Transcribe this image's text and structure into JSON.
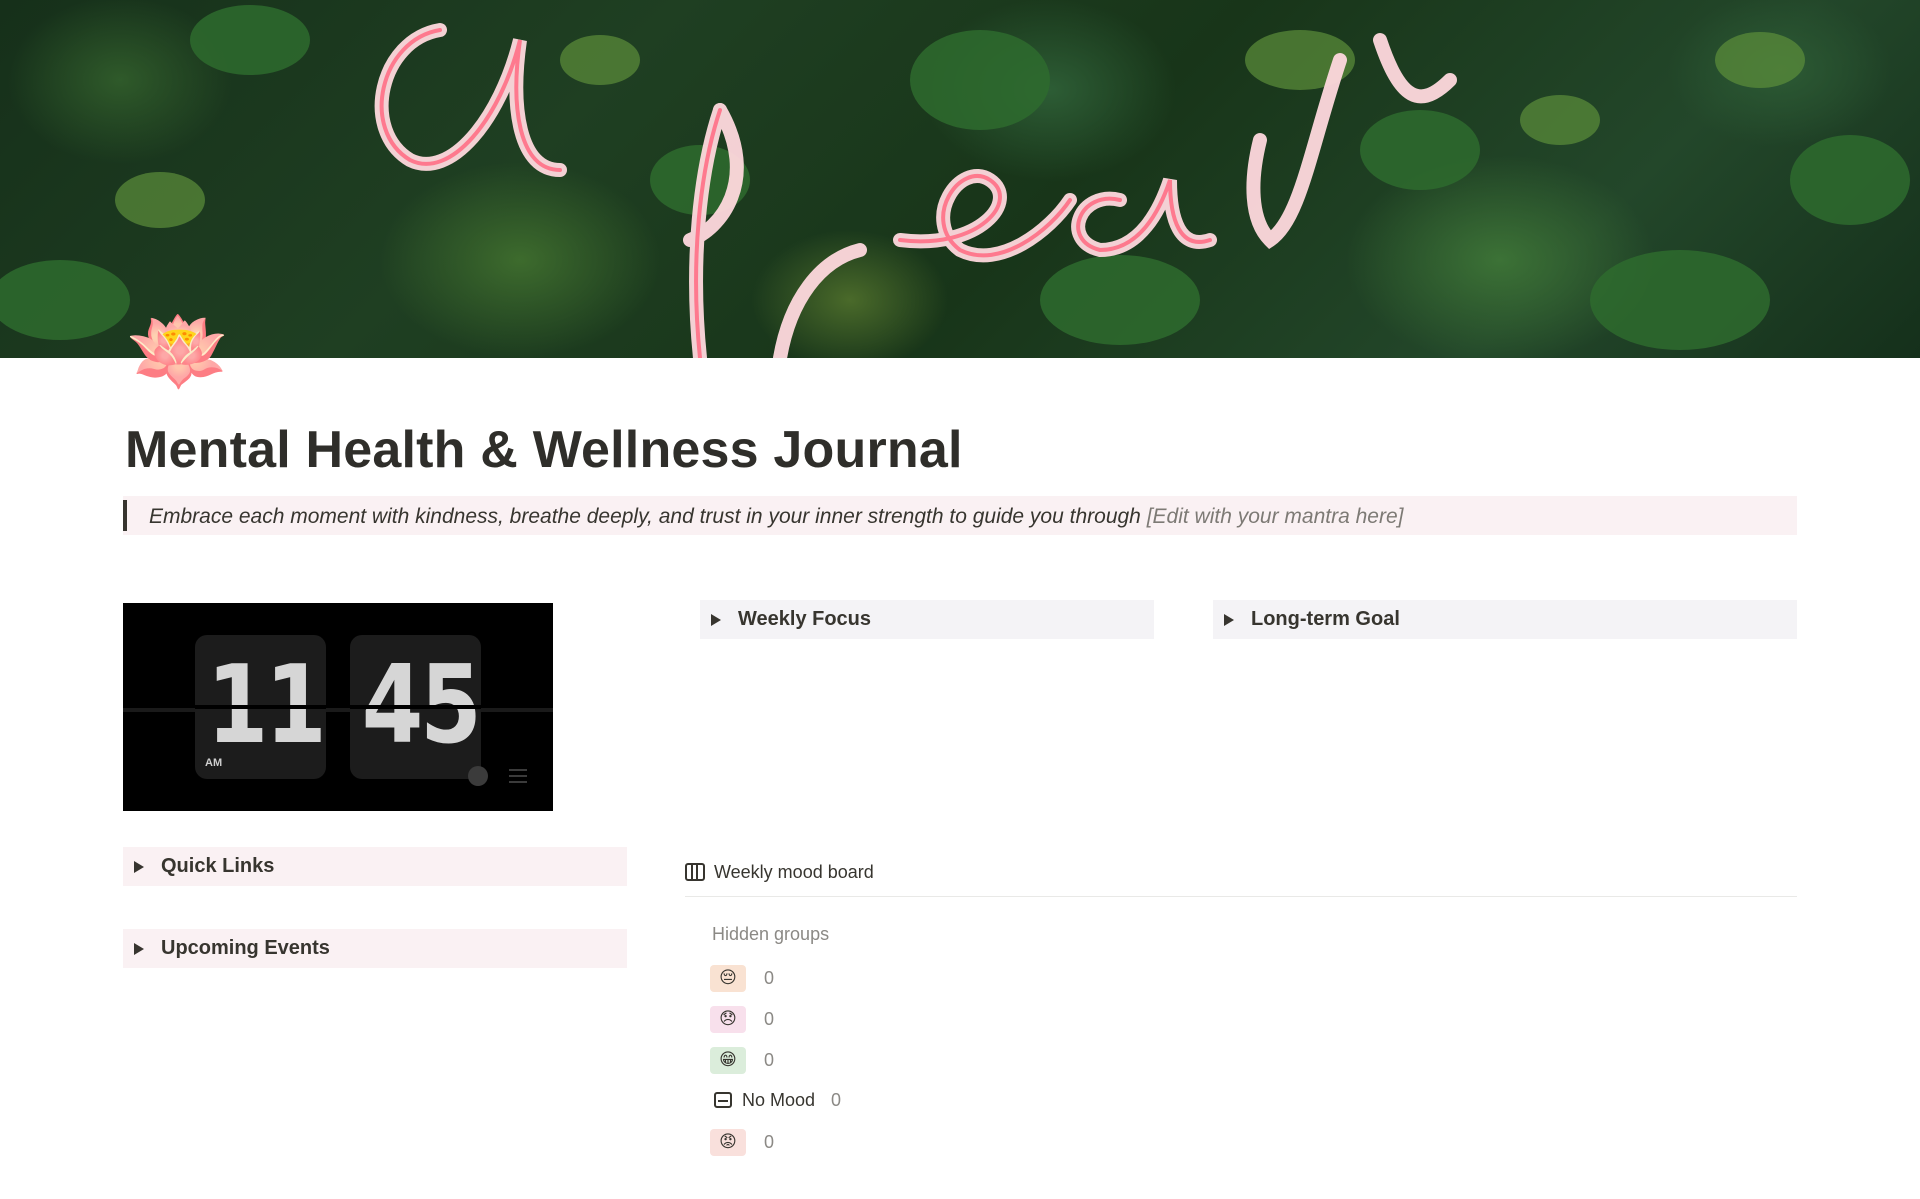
{
  "page": {
    "title": "Mental Health & Wellness Journal",
    "icon": "lotus-icon",
    "cover_text": "and breathe"
  },
  "quote": {
    "text": "Embrace each moment with kindness, breathe deeply, and trust in your inner strength to guide you through",
    "hint": "[Edit with your mantra here]"
  },
  "clock": {
    "hours": "11",
    "minutes": "45",
    "period": "AM"
  },
  "toggles": {
    "weekly_focus": "Weekly Focus",
    "long_term_goal": "Long-term Goal",
    "quick_links": "Quick Links",
    "upcoming_events": "Upcoming Events"
  },
  "mood_board": {
    "title": "Weekly mood board",
    "hidden_groups_label": "Hidden groups",
    "groups": [
      {
        "emoji": "😔",
        "count": "0",
        "color": "#f9e2d2"
      },
      {
        "emoji": "😞",
        "count": "0",
        "color": "#f8e0ec"
      },
      {
        "emoji": "😁",
        "count": "0",
        "color": "#dbeddb"
      },
      {
        "label": "No Mood",
        "count": "0"
      },
      {
        "emoji": "😡",
        "count": "0",
        "color": "#f9e0dc"
      }
    ]
  },
  "colors": {
    "quote_background": "#faf1f3",
    "toggle_pink": "#faf1f3",
    "toggle_grey": "#f4f3f6",
    "text": "#37352f"
  }
}
